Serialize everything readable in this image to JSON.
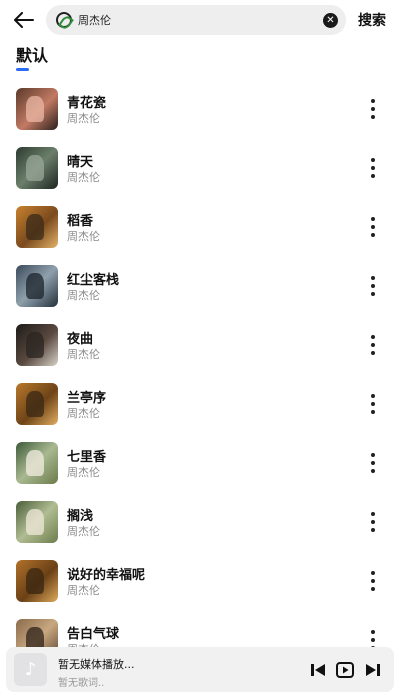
{
  "header": {
    "search_value": "周杰伦",
    "search_button": "搜索"
  },
  "tab": {
    "label": "默认",
    "accent": "#2b6cf6"
  },
  "songs": [
    {
      "title": "青花瓷",
      "artist": "周杰伦"
    },
    {
      "title": "晴天",
      "artist": "周杰伦"
    },
    {
      "title": "稻香",
      "artist": "周杰伦"
    },
    {
      "title": "红尘客栈",
      "artist": "周杰伦"
    },
    {
      "title": "夜曲",
      "artist": "周杰伦"
    },
    {
      "title": "兰亭序",
      "artist": "周杰伦"
    },
    {
      "title": "七里香",
      "artist": "周杰伦"
    },
    {
      "title": "搁浅",
      "artist": "周杰伦"
    },
    {
      "title": "说好的幸福呢",
      "artist": "周杰伦"
    },
    {
      "title": "告白气球",
      "artist": "周杰伦"
    }
  ],
  "player": {
    "title": "暂无媒体播放...",
    "lyrics": "暂无歌词..",
    "icons": [
      "previous-icon",
      "play-icon",
      "next-icon"
    ]
  }
}
